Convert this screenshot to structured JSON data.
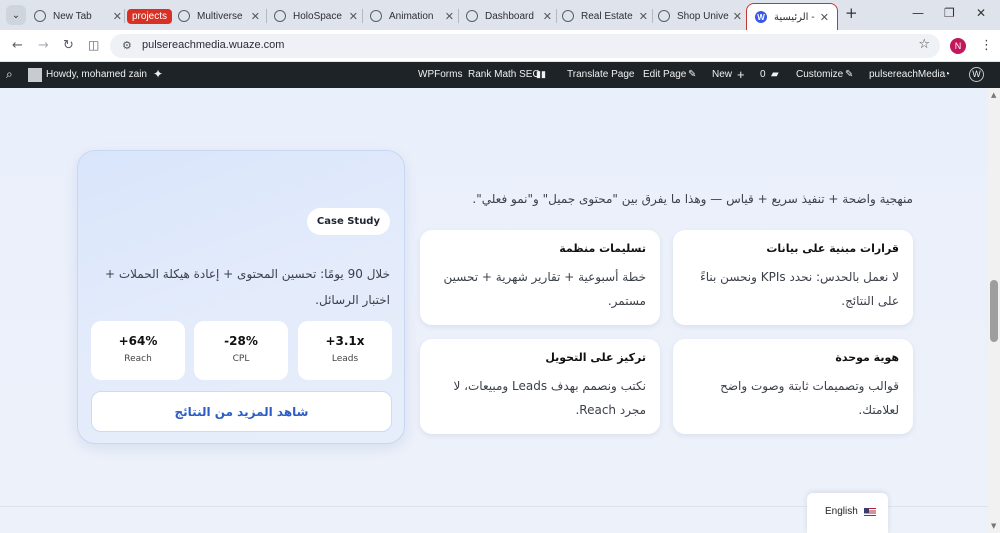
{
  "browser": {
    "tabs": [
      {
        "title": "New Tab"
      },
      {
        "title": "Multiverse"
      },
      {
        "title": "HoloSpace"
      },
      {
        "title": "Animation"
      },
      {
        "title": "Dashboard"
      },
      {
        "title": "Real Estate"
      },
      {
        "title": "Shop Unive"
      },
      {
        "title": "الرئيسية - ≡"
      }
    ],
    "group_label": "projects",
    "url": "pulsereachmedia.wuaze.com",
    "profile_initial": "N"
  },
  "admin_bar": {
    "howdy": "Howdy, mohamed zain",
    "wpforms": "WPForms",
    "rank_math": "Rank Math SEO",
    "translate": "Translate Page",
    "edit_page": "Edit Page",
    "new": "New",
    "comments_count": "0",
    "customize": "Customize",
    "site_name": "pulsereachMedia"
  },
  "intro_text": "منهجية واضحة + تنفيذ سريع + قياس — وهذا ما يفرق بين \"محتوى جميل\" و\"نمو فعلي\".",
  "features": [
    {
      "title": "قرارات مبنية على بيانات",
      "desc": "لا نعمل بالحدس: نحدد KPIs ونحسن بناءً على النتائج."
    },
    {
      "title": "تسليمات منظمة",
      "desc": "خطة أسبوعية + تقارير شهرية + تحسين مستمر."
    },
    {
      "title": "هوية موحدة",
      "desc": "قوالب وتصميمات ثابتة وصوت واضح لعلامتك."
    },
    {
      "title": "تركيز على التحويل",
      "desc": "نكتب ونصمم بهدف Leads ومبيعات، لا مجرد Reach."
    }
  ],
  "case_study": {
    "badge": "Case Study",
    "text": "خلال 90 يومًا: تحسين المحتوى + إعادة هيكلة الحملات + اختبار الرسائل.",
    "stats": [
      {
        "value": "+3.1x",
        "label": "Leads"
      },
      {
        "value": "-28%",
        "label": "CPL"
      },
      {
        "value": "+64%",
        "label": "Reach"
      }
    ],
    "cta": "شاهد المزيد من النتائج"
  },
  "language_switcher": {
    "label": "English"
  }
}
